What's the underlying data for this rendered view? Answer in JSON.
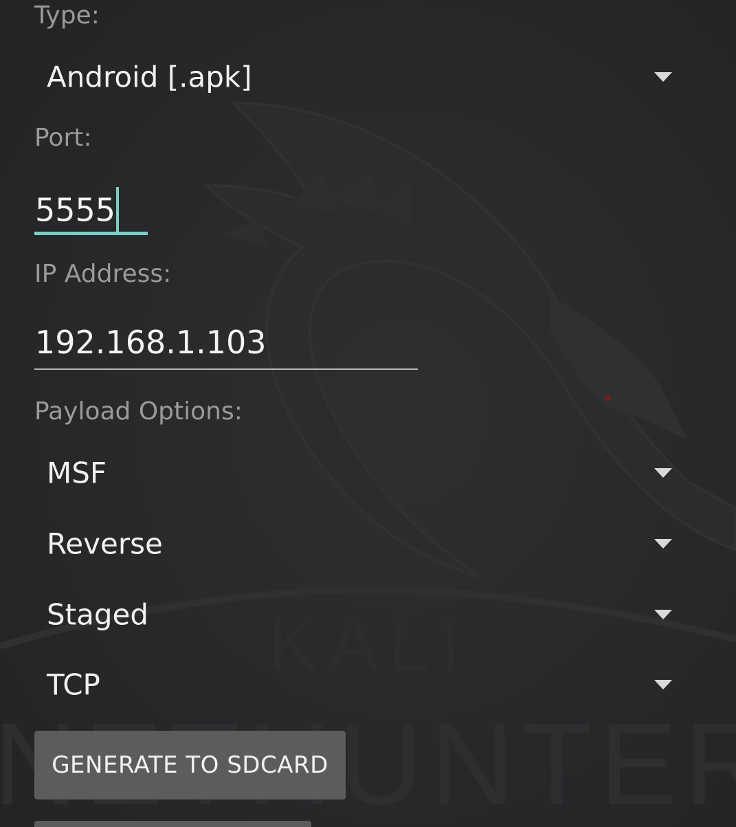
{
  "form": {
    "type_label": "Type:",
    "type_value": "Android [.apk]",
    "port_label": "Port:",
    "port_value": "5555",
    "ip_label": "IP Address:",
    "ip_value": "192.168.1.103",
    "payload_label": "Payload Options:",
    "payload_options": [
      "MSF",
      "Reverse",
      "Staged",
      "TCP"
    ],
    "generate_button": "GENERATE TO SDCARD"
  },
  "background": {
    "watermark_top": "KALI",
    "watermark_bottom": "NETHUNTER"
  },
  "colors": {
    "background": "#262728",
    "accent": "#80cbc4",
    "label": "#9a9a9a",
    "value": "#f1f1f1",
    "button": "#5c5c5c"
  },
  "icons": {
    "dropdown": "triangle-down-icon",
    "background_logo": "kali-dragon-logo"
  }
}
